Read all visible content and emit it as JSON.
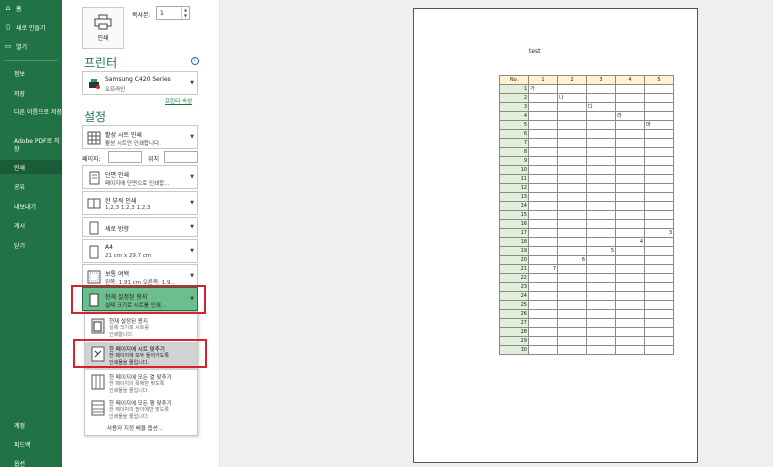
{
  "nav": {
    "items": [
      {
        "icon": "home-icon",
        "glyph": "⌂",
        "label": "홈"
      },
      {
        "icon": "new-file-icon",
        "glyph": "▯",
        "label": "새로 만들기"
      },
      {
        "icon": "open-folder-icon",
        "glyph": "▭",
        "label": "열기"
      },
      {
        "label": "정보"
      },
      {
        "label": "저장"
      },
      {
        "label": "다른 이름으로 저장"
      },
      {
        "label": "Adobe PDF로 저장"
      },
      {
        "label": "인쇄"
      },
      {
        "label": "공유"
      },
      {
        "label": "내보내기"
      },
      {
        "label": "게시"
      },
      {
        "label": "닫기"
      },
      {
        "label": "계정"
      },
      {
        "label": "피드백"
      },
      {
        "label": "옵션"
      }
    ]
  },
  "print": {
    "button_label": "인쇄",
    "copies_label": "복사본:",
    "copies_value": "1"
  },
  "printer": {
    "section_title": "프린터",
    "name": "Samsung C420 Series",
    "status": "오프라인",
    "properties_link": "프린터 속성"
  },
  "settings": {
    "section_title": "설정",
    "print_what": {
      "line1": "활성 시트 인쇄",
      "line2": "활성 시트만 인쇄합니다."
    },
    "pages_label": "페이지:",
    "to_label": "위치",
    "sides": {
      "line1": "단면 인쇄",
      "line2": "페이지에 단면으로 인쇄합..."
    },
    "collate": {
      "line1": "한 부씩 인쇄",
      "line2": "1,2,3    1,2,3    1,2,3"
    },
    "orientation": {
      "line1": "세로 방향"
    },
    "paper": {
      "line1": "A4",
      "line2": "21 cm x 29.7 cm"
    },
    "margins": {
      "line1": "보통 여백",
      "line2": "왼쪽: 1.91 cm  오른쪽: 1.9..."
    },
    "scaling": {
      "line1": "현재 설정된 용지",
      "line2": "실제 크기로 시트를 인쇄..."
    }
  },
  "scaling_menu": {
    "options": [
      {
        "line1": "현재 설정된 용지",
        "line2": "실제 크기로 시트를",
        "line3": "인쇄합니다."
      },
      {
        "line1": "한 페이지에 시트 맞추기",
        "line2": "한 페이지에 모두 들어가도록",
        "line3": "인쇄물을 줄입니다."
      },
      {
        "line1": "한 페이지에 모든 열 맞추기",
        "line2": "한 페이지의 폭에만 맞도록",
        "line3": "인쇄물을 줄입니다."
      },
      {
        "line1": "한 페이지에 모든 행 맞추기",
        "line2": "한 페이지의 높이에만 맞도록",
        "line3": "인쇄물을 줄입니다."
      }
    ],
    "custom_label": "사용자 지정 배율 옵션..."
  },
  "preview": {
    "sheet_title": "test",
    "table_headers": [
      "No.",
      "1",
      "2",
      "3",
      "4",
      "5"
    ],
    "rows": [
      [
        "1",
        "가",
        "",
        "",
        "",
        ""
      ],
      [
        "2",
        "",
        "나",
        "",
        "",
        ""
      ],
      [
        "3",
        "",
        "",
        "다",
        "",
        ""
      ],
      [
        "4",
        "",
        "",
        "",
        "라",
        ""
      ],
      [
        "5",
        "",
        "",
        "",
        "",
        "마"
      ],
      [
        "6",
        "",
        "",
        "",
        "",
        ""
      ],
      [
        "7",
        "",
        "",
        "",
        "",
        ""
      ],
      [
        "8",
        "",
        "",
        "",
        "",
        ""
      ],
      [
        "9",
        "",
        "",
        "",
        "",
        ""
      ],
      [
        "10",
        "",
        "",
        "",
        "",
        ""
      ],
      [
        "11",
        "",
        "",
        "",
        "",
        ""
      ],
      [
        "12",
        "",
        "",
        "",
        "",
        ""
      ],
      [
        "13",
        "",
        "",
        "",
        "",
        ""
      ],
      [
        "14",
        "",
        "",
        "",
        "",
        ""
      ],
      [
        "15",
        "",
        "",
        "",
        "",
        ""
      ],
      [
        "16",
        "",
        "",
        "",
        "",
        ""
      ],
      [
        "17",
        "",
        "",
        "",
        "",
        "3"
      ],
      [
        "18",
        "",
        "",
        "",
        "4",
        ""
      ],
      [
        "19",
        "",
        "",
        "5",
        "",
        ""
      ],
      [
        "20",
        "",
        "6",
        "",
        "",
        ""
      ],
      [
        "21",
        "7",
        "",
        "",
        "",
        ""
      ],
      [
        "22",
        "",
        "",
        "",
        "",
        ""
      ],
      [
        "23",
        "",
        "",
        "",
        "",
        ""
      ],
      [
        "24",
        "",
        "",
        "",
        "",
        ""
      ],
      [
        "25",
        "",
        "",
        "",
        "",
        ""
      ],
      [
        "26",
        "",
        "",
        "",
        "",
        ""
      ],
      [
        "27",
        "",
        "",
        "",
        "",
        ""
      ],
      [
        "28",
        "",
        "",
        "",
        "",
        ""
      ],
      [
        "29",
        "",
        "",
        "",
        "",
        ""
      ],
      [
        "30",
        "",
        "",
        "",
        "",
        ""
      ]
    ]
  },
  "colors": {
    "nav_bg": "#217346",
    "selected_dropdown": "#6dbe8d",
    "highlight_red": "#d3242e",
    "header_fill": "#fff2cc",
    "rownum_fill": "#e2efda"
  }
}
